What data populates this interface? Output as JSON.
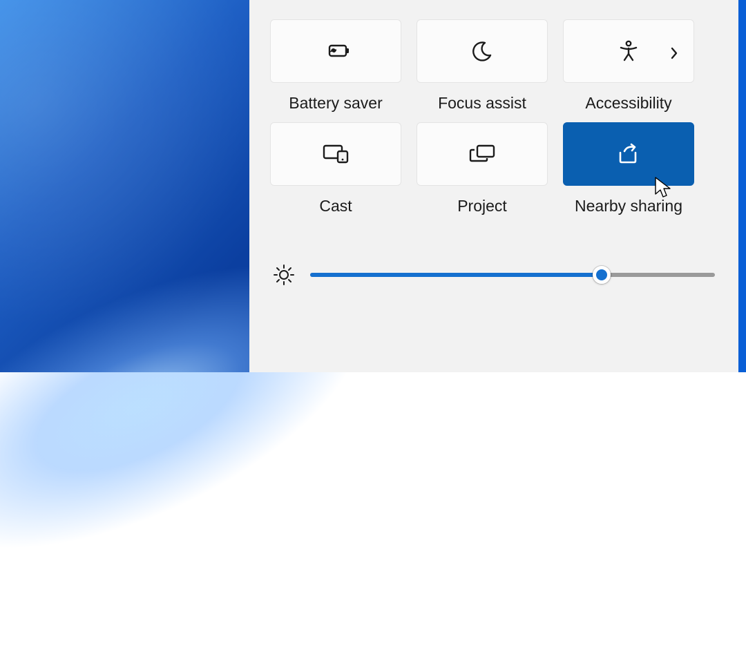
{
  "quickSettings": {
    "tiles": [
      {
        "label": "Battery saver",
        "icon": "battery-saver-icon",
        "active": false,
        "hasSubmenu": false
      },
      {
        "label": "Focus assist",
        "icon": "moon-icon",
        "active": false,
        "hasSubmenu": false
      },
      {
        "label": "Accessibility",
        "icon": "accessibility-icon",
        "active": false,
        "hasSubmenu": true
      },
      {
        "label": "Cast",
        "icon": "cast-icon",
        "active": false,
        "hasSubmenu": false
      },
      {
        "label": "Project",
        "icon": "project-icon",
        "active": false,
        "hasSubmenu": false
      },
      {
        "label": "Nearby sharing",
        "icon": "share-icon",
        "active": true,
        "hasSubmenu": false
      }
    ],
    "brightness": {
      "percent": 72
    }
  },
  "colors": {
    "accentActive": "#0a5fb0",
    "sliderBlue": "#1570cf",
    "desktopBlue": "#1e5fc4"
  }
}
